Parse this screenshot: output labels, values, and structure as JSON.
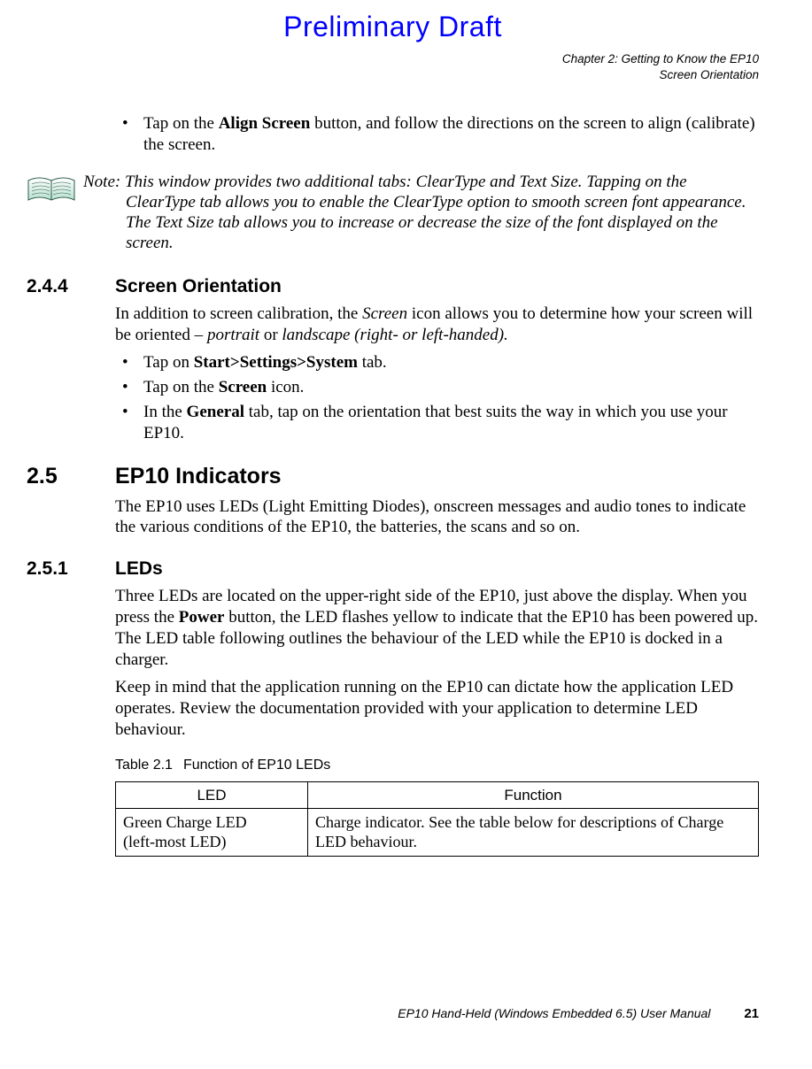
{
  "prelim": "Preliminary Draft",
  "header": {
    "line1": "Chapter 2: Getting to Know the EP10",
    "line2": "Screen Orientation"
  },
  "bullet_top": {
    "pre": "Tap on the ",
    "bold1": "Align Screen",
    "post": " button, and follow the directions on the screen to align (calibrate) the screen."
  },
  "note": {
    "lead": "Note: ",
    "first": "This window provides two additional tabs: ClearType and Text Size. Tapping on the ",
    "rest": "ClearType tab allows you to enable the ClearType option to smooth screen font appearance. The Text Size tab allows you to increase or decrease the size of the font displayed on the screen."
  },
  "s244": {
    "num": "2.4.4",
    "title": "Screen Orientation",
    "p_a": "In addition to screen calibration, the ",
    "p_b": "Screen",
    "p_c": " icon allows you to determine how your screen will be oriented – ",
    "p_d": "portrait",
    "p_e": " or ",
    "p_f": "landscape (right- or left-handed).",
    "b1_a": "Tap on ",
    "b1_b": "Start>Settings>System",
    "b1_c": " tab.",
    "b2_a": "Tap on the ",
    "b2_b": "Screen",
    "b2_c": " icon.",
    "b3_a": "In the ",
    "b3_b": "General",
    "b3_c": " tab, tap on the orientation that best suits the way in which you use your EP10."
  },
  "s25": {
    "num": "2.5",
    "title": "EP10 Indicators",
    "p": "The EP10 uses LEDs (Light Emitting Diodes), onscreen messages and audio tones to indicate the various conditions of the EP10, the batteries, the scans and so on."
  },
  "s251": {
    "num": "2.5.1",
    "title": "LEDs",
    "p1_a": "Three LEDs are located on the upper-right side of the EP10, just above the display. When you press the ",
    "p1_b": "Power",
    "p1_c": " button, the LED flashes yellow to indicate that the EP10 has been powered up. The LED table following outlines the behaviour of the LED while the EP10 is docked in a charger.",
    "p2": "Keep in mind that the application running on the EP10 can dictate how the application LED operates. Review the documentation provided with your application to determine LED behaviour."
  },
  "table": {
    "caption_lead": "Table 2.1",
    "caption_title": "Function of EP10 LEDs",
    "h1": "LED",
    "h2": "Function",
    "r1c1_a": "Green Charge LED",
    "r1c1_b": "(left-most LED)",
    "r1c2": "Charge indicator. See the table below for descriptions of Charge LED behaviour."
  },
  "footer": {
    "title": "EP10 Hand-Held (Windows Embedded 6.5) User Manual",
    "page": "21"
  }
}
